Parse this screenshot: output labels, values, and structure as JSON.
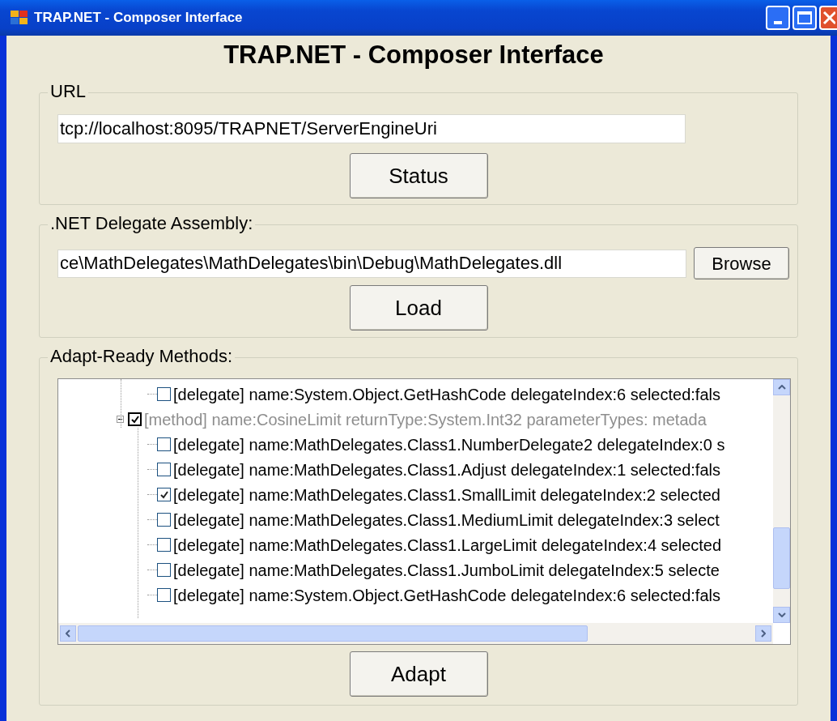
{
  "window": {
    "title": "TRAP.NET - Composer Interface"
  },
  "heading": "TRAP.NET - Composer Interface",
  "url_group": {
    "label": "URL",
    "value": "tcp://localhost:8095/TRAPNET/ServerEngineUri",
    "button": "Status"
  },
  "assembly_group": {
    "label": ".NET Delegate Assembly:",
    "value": "ce\\MathDelegates\\MathDelegates\\bin\\Debug\\MathDelegates.dll",
    "browse_button": "Browse",
    "button": "Load"
  },
  "methods_group": {
    "label": "Adapt-Ready Methods:",
    "tree": [
      {
        "kind": "offscreen",
        "children": [
          {
            "kind": "delegate",
            "text": "[delegate] name:System.Object.GetHashCode delegateIndex:6 selected:fals",
            "checked": false
          }
        ]
      },
      {
        "kind": "method",
        "text": "[method] name:CosineLimit returnType:System.Int32 parameterTypes: metada",
        "checked": true,
        "expanded": true,
        "disabled": true,
        "children": [
          {
            "kind": "delegate",
            "text": "[delegate] name:MathDelegates.Class1.NumberDelegate2 delegateIndex:0 s",
            "checked": false
          },
          {
            "kind": "delegate",
            "text": "[delegate] name:MathDelegates.Class1.Adjust delegateIndex:1 selected:fals",
            "checked": false
          },
          {
            "kind": "delegate",
            "text": "[delegate] name:MathDelegates.Class1.SmallLimit delegateIndex:2 selected",
            "checked": true
          },
          {
            "kind": "delegate",
            "text": "[delegate] name:MathDelegates.Class1.MediumLimit delegateIndex:3 select",
            "checked": false
          },
          {
            "kind": "delegate",
            "text": "[delegate] name:MathDelegates.Class1.LargeLimit delegateIndex:4 selected",
            "checked": false
          },
          {
            "kind": "delegate",
            "text": "[delegate] name:MathDelegates.Class1.JumboLimit delegateIndex:5 selecte",
            "checked": false
          },
          {
            "kind": "delegate",
            "text": "[delegate] name:System.Object.GetHashCode delegateIndex:6 selected:fals",
            "checked": false
          }
        ]
      }
    ],
    "button": "Adapt"
  }
}
